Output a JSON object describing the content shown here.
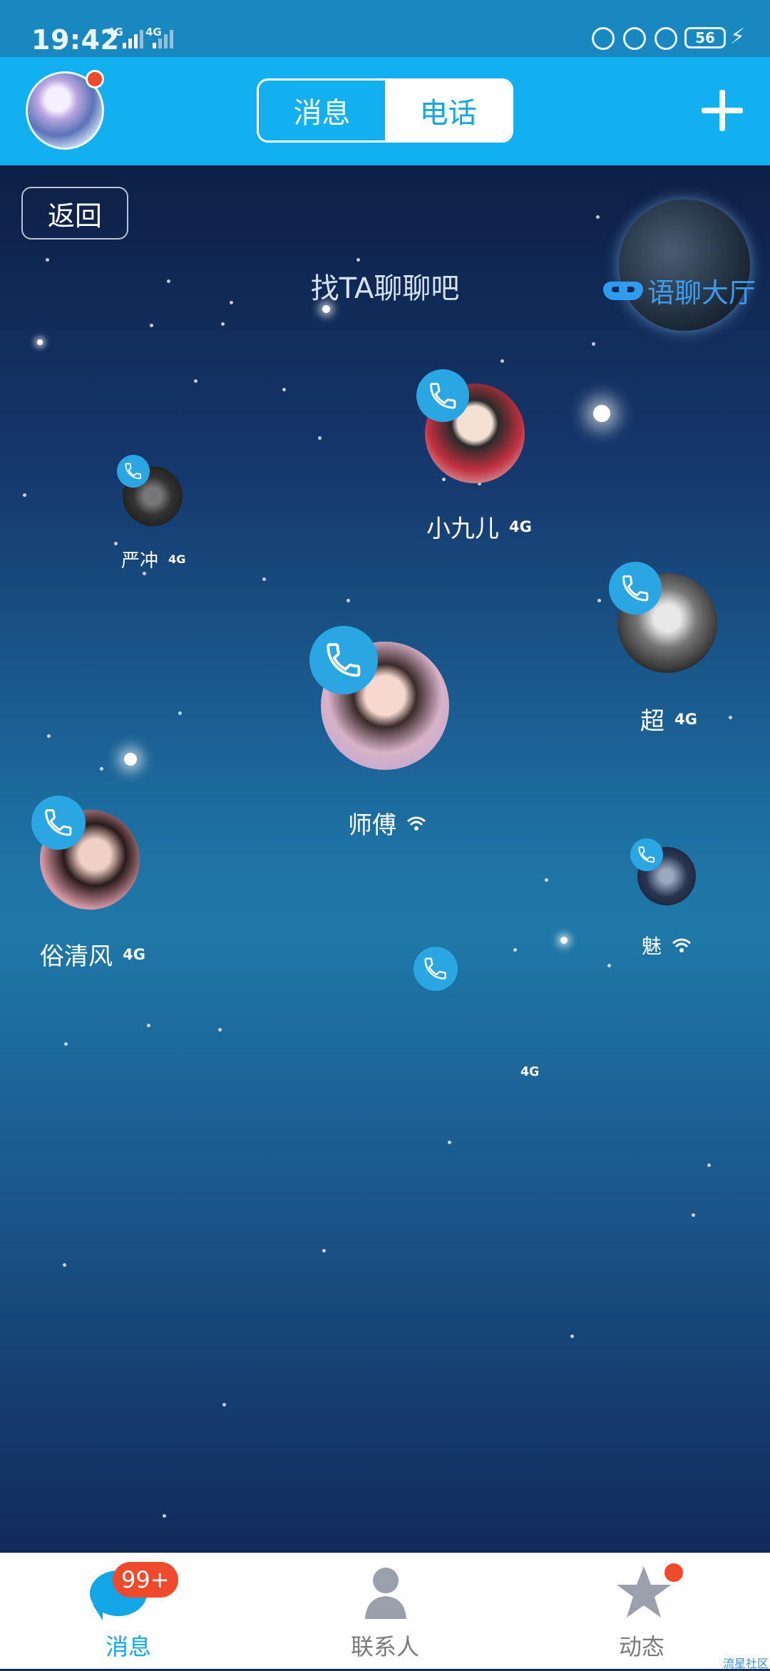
{
  "status_bar": {
    "time": "19:42",
    "sig1": "4G",
    "sig2": "4G",
    "battery": "56"
  },
  "header": {
    "tabs": {
      "messages": "消息",
      "calls": "电话"
    },
    "add_icon": "plus-icon",
    "avatar_icon": "profile-avatar"
  },
  "main": {
    "back": "返回",
    "title": "找TA聊聊吧",
    "hall": "语聊大厅",
    "users": [
      {
        "name": "小九儿",
        "net": "4G",
        "net_type": "cell"
      },
      {
        "name": "严冲",
        "net": "4G",
        "net_type": "cell"
      },
      {
        "name": "超",
        "net": "4G",
        "net_type": "cell"
      },
      {
        "name": "师傅",
        "net": "",
        "net_type": "wifi"
      },
      {
        "name": "俗清风",
        "net": "4G",
        "net_type": "cell"
      },
      {
        "name": "魅",
        "net": "",
        "net_type": "wifi"
      },
      {
        "name": "",
        "net": "4G",
        "net_type": "cell"
      }
    ]
  },
  "nav": {
    "messages": "消息",
    "messages_badge": "99+",
    "contacts": "联系人",
    "moments": "动态"
  },
  "watermark": "流星社区",
  "colors": {
    "accent": "#12b0ef",
    "badge": "#f04a2c",
    "call": "#2aa6e2"
  }
}
